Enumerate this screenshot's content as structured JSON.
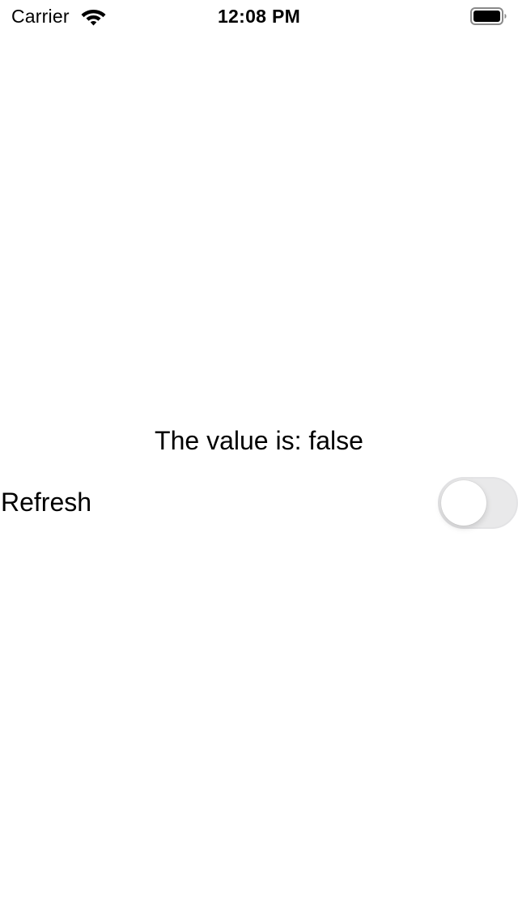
{
  "status_bar": {
    "carrier": "Carrier",
    "time": "12:08 PM",
    "wifi_icon": "wifi-icon",
    "battery_icon": "battery-icon"
  },
  "content": {
    "value_text": "The value is: false",
    "refresh_label": "Refresh",
    "refresh_toggle": {
      "on": false,
      "track_color": "#e9e9ea",
      "knob_color": "#ffffff"
    }
  }
}
